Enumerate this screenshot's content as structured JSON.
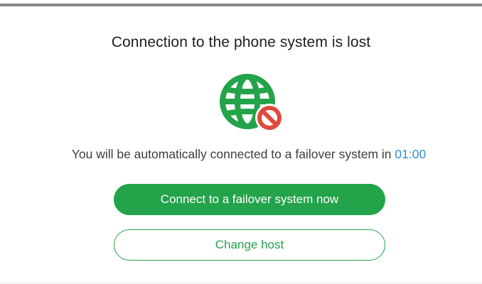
{
  "dialog": {
    "title": "Connection to the phone system is lost",
    "icon": "globe-blocked-icon",
    "message_prefix": "You will be automatically connected to a failover system in ",
    "countdown": "01:00",
    "primary_button_label": "Connect to a failover system now",
    "secondary_button_label": "Change host"
  },
  "colors": {
    "accent_green": "#23a34a",
    "countdown_blue": "#2f8fdb",
    "error_red": "#e14a3b",
    "top_bar_gray": "#858585"
  }
}
